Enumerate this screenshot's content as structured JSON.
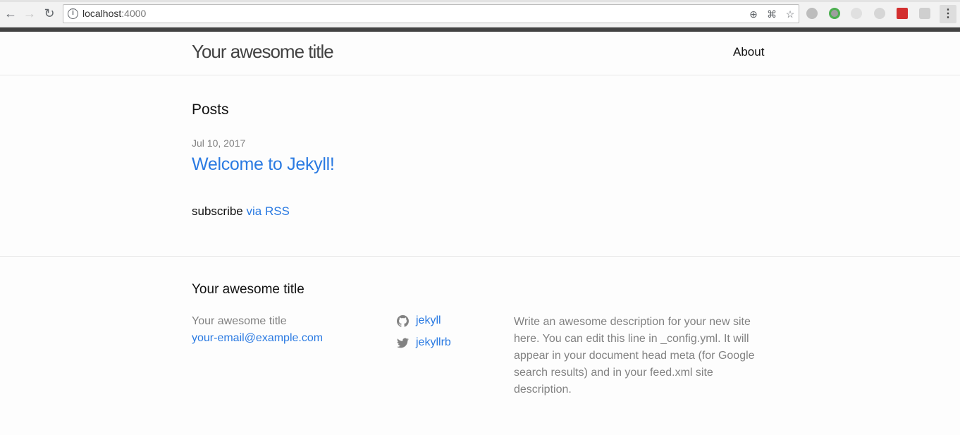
{
  "browser": {
    "url_host": "localhost",
    "url_port": ":4000"
  },
  "header": {
    "site_title": "Your awesome title",
    "nav_about": "About"
  },
  "main": {
    "posts_heading": "Posts",
    "posts": [
      {
        "date": "Jul 10, 2017",
        "title": "Welcome to Jekyll!"
      }
    ],
    "subscribe_prefix": "subscribe ",
    "subscribe_link": "via RSS"
  },
  "footer": {
    "heading": "Your awesome title",
    "name": "Your awesome title",
    "email": "your-email@example.com",
    "github_username": "jekyll",
    "twitter_username": "jekyllrb",
    "description": "Write an awesome description for your new site here. You can edit this line in _config.yml. It will appear in your document head meta (for Google search results) and in your feed.xml site description."
  },
  "colors": {
    "link": "#2a7ae2",
    "text": "#111111",
    "muted": "#828282",
    "header_bar": "#424242"
  },
  "icons": [
    "back-arrow-icon",
    "forward-arrow-icon",
    "reload-icon",
    "info-icon",
    "zoom-icon",
    "translate-icon",
    "star-icon",
    "extension-icon",
    "menu-icon",
    "github-icon",
    "twitter-icon"
  ]
}
